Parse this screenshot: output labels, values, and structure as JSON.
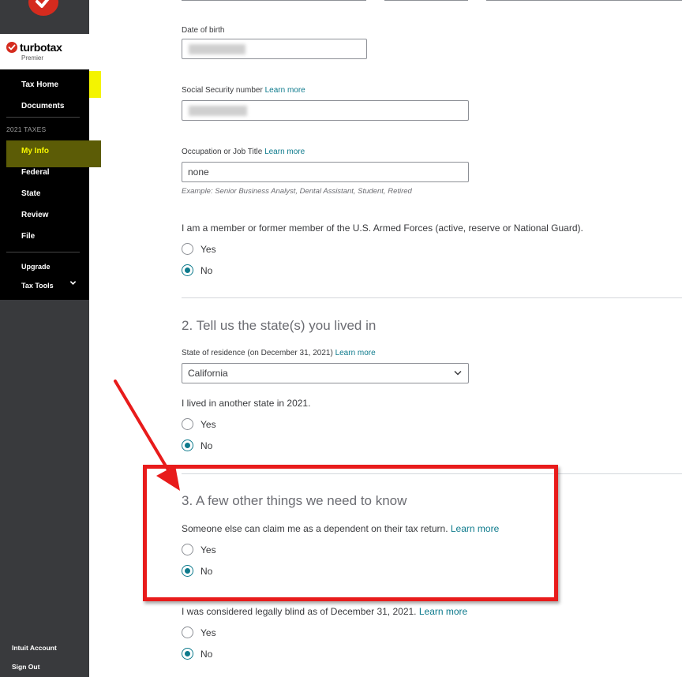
{
  "sidebar": {
    "brand": {
      "name": "turbotax",
      "tier": "Premier"
    },
    "nav": [
      {
        "label": "Tax Home"
      },
      {
        "label": "Documents"
      }
    ],
    "year_label": "2021 TAXES",
    "steps": [
      {
        "label": "My Info",
        "active": true
      },
      {
        "label": "Federal"
      },
      {
        "label": "State"
      },
      {
        "label": "Review"
      },
      {
        "label": "File"
      }
    ],
    "extras": [
      {
        "label": "Upgrade"
      },
      {
        "label": "Tax Tools"
      }
    ],
    "footer": [
      {
        "label": "Intuit Account"
      },
      {
        "label": "Sign Out"
      }
    ]
  },
  "form": {
    "dob": {
      "label": "Date of birth"
    },
    "ssn": {
      "label": "Social Security number",
      "learn_more": "Learn more"
    },
    "occupation": {
      "label": "Occupation or Job Title",
      "learn_more": "Learn more",
      "value": "none",
      "hint": "Example: Senior Business Analyst, Dental Assistant, Student, Retired"
    },
    "armed_forces": {
      "question": "I am a member or former member of the U.S. Armed Forces (active, reserve or National Guard).",
      "options": [
        "Yes",
        "No"
      ],
      "selected": "No"
    },
    "section2": {
      "title": "2. Tell us the state(s) you lived in",
      "residence_label": "State of residence (on December 31, 2021)",
      "learn_more": "Learn more",
      "residence_value": "California",
      "other_state_question": "I lived in another state in 2021.",
      "options": [
        "Yes",
        "No"
      ],
      "selected": "No"
    },
    "section3": {
      "title": "3. A few other things we need to know",
      "dependent_question": "Someone else can claim me as a dependent on their tax return.",
      "dependent_learn_more": "Learn more",
      "dependent_options": [
        "Yes",
        "No"
      ],
      "dependent_selected": "No",
      "blind_question": "I was considered legally blind as of December 31, 2021.",
      "blind_learn_more": "Learn more",
      "blind_options": [
        "Yes",
        "No"
      ],
      "blind_selected": "No"
    }
  },
  "colors": {
    "sidebar_bg": "#000000",
    "sidebar_rail": "#393a3d",
    "brand_red": "#d52b1e",
    "accent_teal": "#0d7a8c",
    "annotation_red": "#e81b1b",
    "highlight_yellow": "#f4f400"
  }
}
